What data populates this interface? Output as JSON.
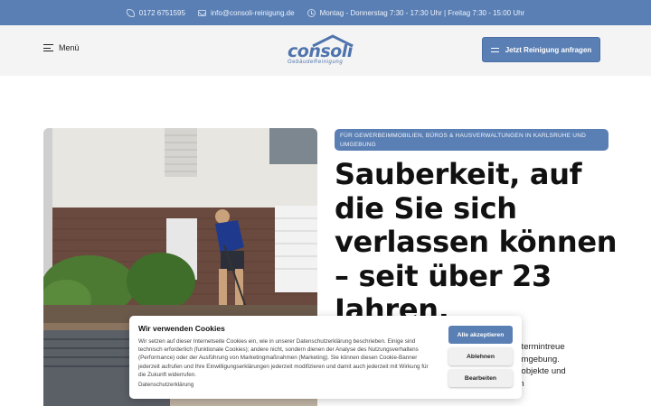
{
  "topbar": {
    "phone": "0172 6751595",
    "email": "info@consoli-reinigung.de",
    "hours": "Montag - Donnerstag 7:30 - 17:30 Uhr | Freitag 7:30 - 15:00 Uhr"
  },
  "header": {
    "menu_label": "Menü",
    "logo_word": "consoli",
    "logo_sub": "GebäudeReinigung",
    "cta_label": "Jetzt Reinigung anfragen"
  },
  "hero": {
    "tag": "FÜR GEWERBEIMMOBILIEN, BÜROS & HAUSVERWALTUNGEN IN KARLSRUHE UND UMGEBUNG",
    "headline_lines": [
      "Sauberkeit, auf",
      "die Sie sich",
      "verlassen können",
      "– seit über 23",
      "Jahren."
    ],
    "body_lines": [
      "sige und termintreue",
      "en und Umgebung.",
      "Gewerbeobjekte und",
      "em klaren"
    ]
  },
  "cookie": {
    "title": "Wir verwenden Cookies",
    "text": "Wir setzen auf dieser Internetseite Cookies ein, wie in unserer Datenschutzerklärung beschrieben. Einige sind technisch erforderlich (funktionale Cookies); andere nicht, sondern dienen der Analyse des Nutzungsverhaltens (Performance) oder der Ausführung von Marketingmaßnahmen (Marketing). Sie können diesen Cookie-Banner jederzeit aufrufen und Ihre Einwilligungserklärungen jederzeit modifizieren und damit auch jederzeit mit Wirkung für die Zukunft widerrufen.",
    "link": "Datenschutzerklärung",
    "accept_all": "Alle akzeptieren",
    "decline": "Ablehnen",
    "edit": "Bearbeiten"
  },
  "colors": {
    "brand": "#5a7fb4",
    "header_bg": "#f4f4f4"
  },
  "icons": {
    "phone": "phone-icon",
    "email": "mail-icon",
    "hours": "clock-icon",
    "menu": "hamburger-icon",
    "cta": "arrows-icon"
  }
}
